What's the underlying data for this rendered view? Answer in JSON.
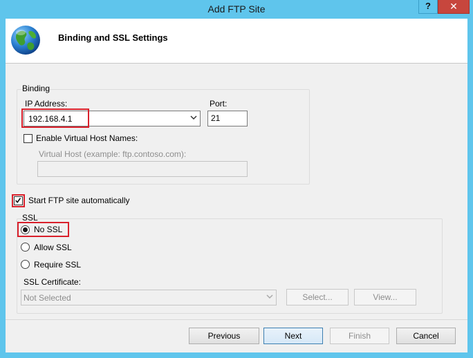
{
  "window": {
    "title": "Add FTP Site",
    "help_label": "?",
    "close_label": "✕",
    "titlebar_color": "#5fc5ec",
    "close_color": "#c7463d",
    "highlight_color": "#d9202b"
  },
  "header": {
    "title": "Binding and SSL Settings",
    "icon": "globe-icon"
  },
  "binding": {
    "group_label": "Binding",
    "ip_label": "IP Address:",
    "ip_value": "192.168.4.1",
    "port_label": "Port:",
    "port_value": "21",
    "virtual_host_check_label": "Enable Virtual Host Names:",
    "virtual_host_checked": false,
    "virtual_host_label": "Virtual Host (example: ftp.contoso.com):",
    "virtual_host_value": ""
  },
  "start_auto": {
    "label": "Start FTP site automatically",
    "checked": true
  },
  "ssl": {
    "group_label": "SSL",
    "options": [
      {
        "label": "No SSL",
        "selected": true
      },
      {
        "label": "Allow SSL",
        "selected": false
      },
      {
        "label": "Require SSL",
        "selected": false
      }
    ],
    "cert_label": "SSL Certificate:",
    "cert_value": "Not Selected",
    "select_button": "Select...",
    "view_button": "View..."
  },
  "footer": {
    "previous": "Previous",
    "next": "Next",
    "finish": "Finish",
    "cancel": "Cancel"
  }
}
